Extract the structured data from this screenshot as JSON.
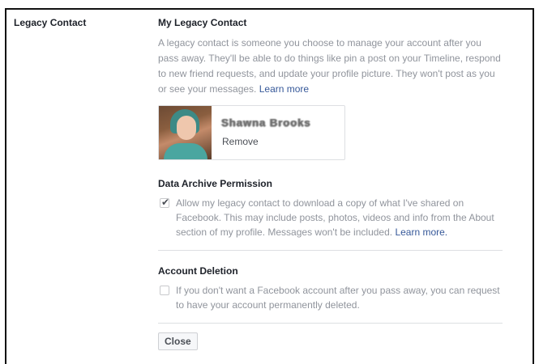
{
  "section_label": "Legacy Contact",
  "legacy": {
    "heading": "My Legacy Contact",
    "description": "A legacy contact is someone you choose to manage your account after you pass away. They'll be able to do things like pin a post on your Timeline, respond to new friend requests, and update your profile picture. They won't post as you or see your messages.",
    "learn_more": "Learn more"
  },
  "contact": {
    "name": "Shawna Brooks",
    "remove_label": "Remove"
  },
  "archive": {
    "heading": "Data Archive Permission",
    "checked": true,
    "text": "Allow my legacy contact to download a copy of what I've shared on Facebook. This may include posts, photos, videos and info from the About section of my profile. Messages won't be included.",
    "learn_more": "Learn more."
  },
  "deletion": {
    "heading": "Account Deletion",
    "checked": false,
    "text": "If you don't want a Facebook account after you pass away, you can request to have your account permanently deleted."
  },
  "close_label": "Close"
}
